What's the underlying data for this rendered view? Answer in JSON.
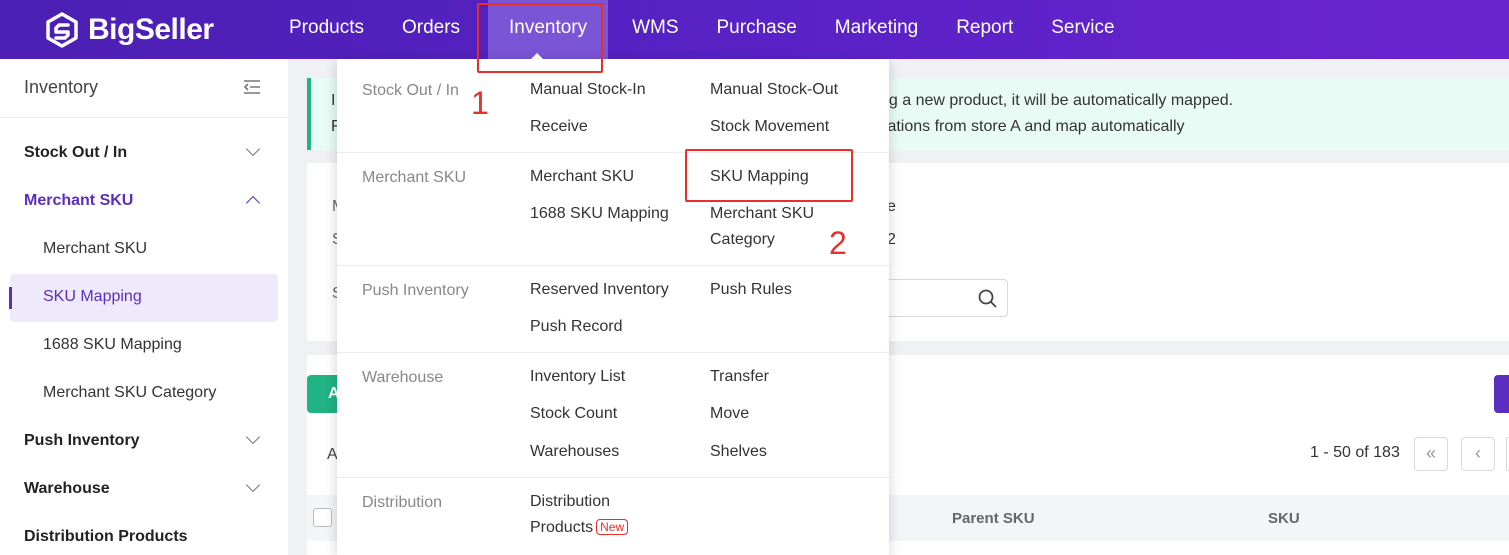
{
  "brand": {
    "name": "BigSeller"
  },
  "nav": [
    "Products",
    "Orders",
    "Inventory",
    "WMS",
    "Purchase",
    "Marketing",
    "Report",
    "Service"
  ],
  "sidebar": {
    "title": "Inventory",
    "items": [
      {
        "label": "Stock Out / In"
      },
      {
        "label": "Merchant SKU"
      },
      {
        "label": "Push Inventory"
      },
      {
        "label": "Warehouse"
      },
      {
        "label": "Distribution Products"
      }
    ],
    "sub_items": [
      "Merchant SKU",
      "SKU Mapping",
      "1688 SKU Mapping",
      "Merchant SKU Category"
    ]
  },
  "notice": {
    "prefix1": "I",
    "line1": "ng a new product, it will be automatically mapped.",
    "prefix2": "F",
    "line2": "elations from store A and map automatically"
  },
  "filters": {
    "frag1": "M",
    "frag2": "S",
    "frag3": "S",
    "right1": "e",
    "right2": "2"
  },
  "toolbar": {
    "add_label": "A"
  },
  "list": {
    "all_label": "A"
  },
  "pagination": {
    "range": "1 - 50 of 183"
  },
  "table": {
    "columns": [
      "Parent SKU",
      "SKU"
    ]
  },
  "dropdown": {
    "groups": [
      {
        "label": "Stock Out / In",
        "links": [
          "Manual Stock-In",
          "Manual Stock-Out",
          "Receive",
          "Stock Movement"
        ]
      },
      {
        "label": "Merchant SKU",
        "links": [
          "Merchant SKU",
          "SKU Mapping",
          "1688 SKU Mapping",
          "Merchant SKU Category"
        ]
      },
      {
        "label": "Push Inventory",
        "links": [
          "Reserved Inventory",
          "Push Rules",
          "Push Record"
        ]
      },
      {
        "label": "Warehouse",
        "links": [
          "Inventory List",
          "Transfer",
          "Stock Count",
          "Move",
          "Warehouses",
          "Shelves"
        ]
      },
      {
        "label": "Distribution",
        "links": [
          "Distribution",
          "Products"
        ],
        "badge": "New"
      }
    ]
  },
  "annotations": [
    "1",
    "2"
  ],
  "colors": {
    "nav_bg": "#5a22c7",
    "accent": "#5b2ec0",
    "highlight": "#e8302a",
    "success": "#20b383"
  }
}
